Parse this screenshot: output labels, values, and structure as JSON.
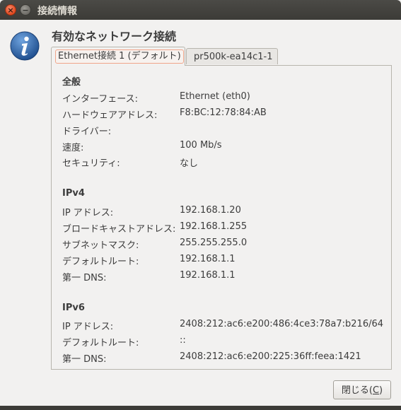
{
  "window": {
    "title": "接続情報"
  },
  "header": {
    "title": "有効なネットワーク接続"
  },
  "tabs": [
    {
      "label": "Ethernet接続 1 (デフォルト)",
      "active": true
    },
    {
      "label": "pr500k-ea14c1-1",
      "active": false
    }
  ],
  "general": {
    "title": "全般",
    "rows": [
      {
        "label": "インターフェース:",
        "value": "Ethernet (eth0)"
      },
      {
        "label": "ハードウェアアドレス:",
        "value": "F8:BC:12:78:84:AB"
      },
      {
        "label": "ドライバー:",
        "value": ""
      },
      {
        "label": "速度:",
        "value": "100 Mb/s"
      },
      {
        "label": "セキュリティ:",
        "value": "なし"
      }
    ]
  },
  "ipv4": {
    "title": "IPv4",
    "rows": [
      {
        "label": "IP アドレス:",
        "value": "192.168.1.20"
      },
      {
        "label": "ブロードキャストアドレス:",
        "value": "192.168.1.255"
      },
      {
        "label": "サブネットマスク:",
        "value": "255.255.255.0"
      },
      {
        "label": "デフォルトルート:",
        "value": "192.168.1.1"
      },
      {
        "label": "第一 DNS:",
        "value": "192.168.1.1"
      }
    ]
  },
  "ipv6": {
    "title": "IPv6",
    "rows": [
      {
        "label": "IP アドレス:",
        "value": "2408:212:ac6:e200:486:4ce3:78a7:b216/64"
      },
      {
        "label": "デフォルトルート:",
        "value": "::"
      },
      {
        "label": "第一 DNS:",
        "value": "2408:212:ac6:e200:225:36ff:feea:1421"
      }
    ]
  },
  "buttons": {
    "close_prefix": "閉じる(",
    "close_mnemonic": "C",
    "close_suffix": ")"
  },
  "icons": {
    "window_close": "close-icon",
    "window_minimize": "minimize-icon",
    "info": "info-icon"
  },
  "colors": {
    "close_button": "#e0481f",
    "titlebar": "#3c3b37",
    "info_blue": "#2c63a6"
  }
}
